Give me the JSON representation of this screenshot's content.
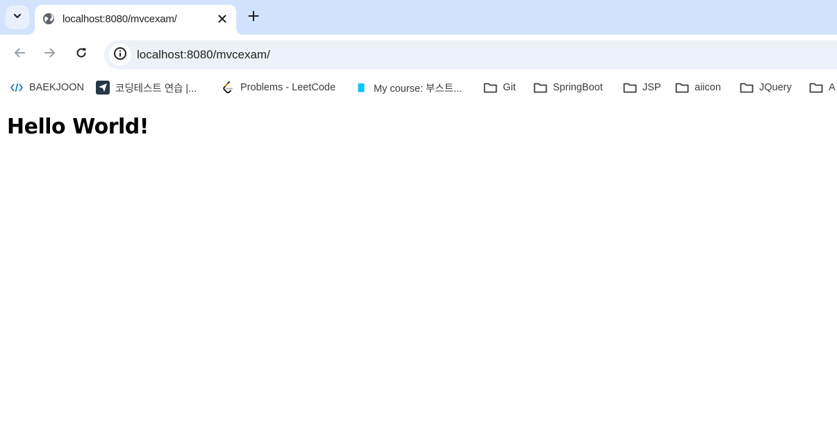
{
  "tab": {
    "title": "localhost:8080/mvcexam/"
  },
  "omnibox": {
    "url": "localhost:8080/mvcexam/"
  },
  "bookmarks": [
    {
      "label": "BAEKJOON",
      "icon": "baekjoon-icon"
    },
    {
      "label": "코딩테스트 연습 |...",
      "icon": "programmers-icon"
    },
    {
      "label": "Problems - LeetCode",
      "icon": "leetcode-icon"
    },
    {
      "label": "My course: 부스트...",
      "icon": "boostcourse-icon"
    },
    {
      "label": "Git",
      "icon": "folder-icon"
    },
    {
      "label": "SpringBoot",
      "icon": "folder-icon"
    },
    {
      "label": "JSP",
      "icon": "folder-icon"
    },
    {
      "label": "aiicon",
      "icon": "folder-icon"
    },
    {
      "label": "JQuery",
      "icon": "folder-icon"
    },
    {
      "label": "A",
      "icon": "folder-icon"
    }
  ],
  "page": {
    "heading": "Hello World!"
  },
  "colors": {
    "tabstrip_bg": "#d3e3fd",
    "omnibox_bg": "#edf1f9",
    "boostcourse_accent": "#00c6ff",
    "leetcode_accent": "#ffa116"
  }
}
